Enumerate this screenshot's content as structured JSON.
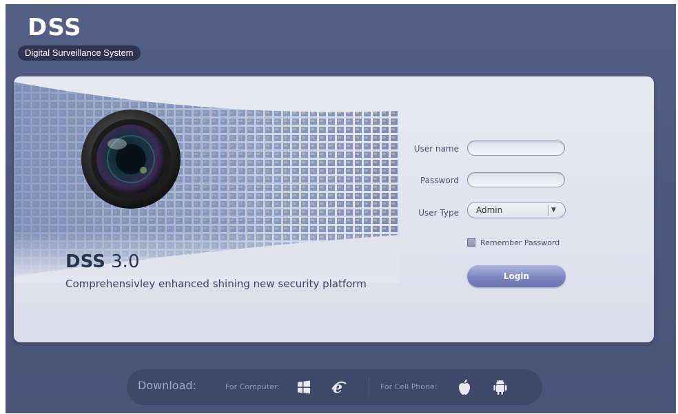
{
  "brand": {
    "logo": "DSS",
    "tagline": "Digital Surveillance System"
  },
  "hero": {
    "title_bold": "DSS",
    "title_version": "3.0",
    "subtitle": "Comprehensivley enhanced shining new security platform"
  },
  "login_form": {
    "username_label": "User name",
    "username_value": "",
    "password_label": "Password",
    "password_value": "",
    "user_type_label": "User Type",
    "user_type_value": "Admin",
    "remember_label": "Remember Password",
    "remember_checked": false,
    "login_label": "Login"
  },
  "download": {
    "title": "Download:",
    "computer_label": "For Computer:",
    "computer_icons": [
      "windows-icon",
      "internet-explorer-icon"
    ],
    "phone_label": "For Cell Phone:",
    "phone_icons": [
      "apple-icon",
      "android-icon"
    ]
  },
  "colors": {
    "background": "#4f5a80",
    "panel": "#e3e6f0",
    "accent": "#7d86c0",
    "download_bar": "#404868"
  }
}
